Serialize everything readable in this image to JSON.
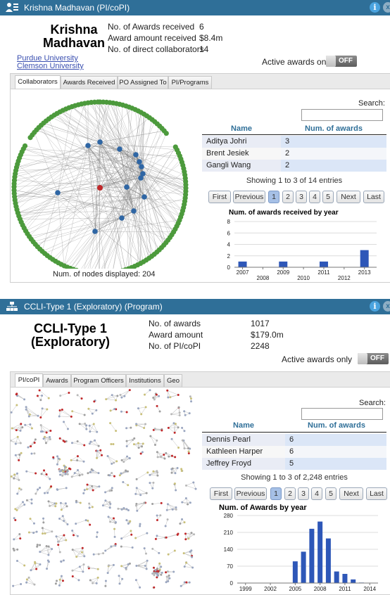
{
  "p1": {
    "title": "Krishna Madhavan (PI/coPI)",
    "info_glyph": "i",
    "close_glyph": "x",
    "name_line1": "Krishna",
    "name_line2": "Madhavan",
    "stats": [
      {
        "label": "No. of Awards received",
        "value": "6"
      },
      {
        "label": "Award amount received",
        "value": "$8.4m"
      },
      {
        "label": "No. of direct collaborators",
        "value": "14"
      }
    ],
    "links": [
      "Purdue University",
      "Clemson University"
    ],
    "active_label": "Active awards only",
    "toggle_label": "OFF",
    "tabs": [
      "Collaborators",
      "Awards Received",
      "PO Assigned To",
      "PI/Programs"
    ],
    "search_label": "Search:",
    "columns": [
      "Name",
      "Num. of awards"
    ],
    "rows": [
      {
        "name": "Aditya Johri",
        "value": "3"
      },
      {
        "name": "Brent Jesiek",
        "value": "2"
      },
      {
        "name": "Gangli Wang",
        "value": "2"
      }
    ],
    "showing": "Showing 1 to 3 of 14 entries",
    "pager": [
      "First",
      "Previous",
      "1",
      "2",
      "3",
      "4",
      "5",
      "Next",
      "Last"
    ],
    "nodes_label": "Num. of nodes displayed: 204",
    "colors": {
      "node_blue": "#2f66a4",
      "node_red": "#c0282a",
      "ring_green": "#4c9a3c",
      "bar": "#2e57b8"
    }
  },
  "p2": {
    "title": "CCLI-Type 1 (Exploratory) (Program)",
    "info_glyph": "i",
    "close_glyph": "x",
    "name_line1": "CCLI-Type 1",
    "name_line2": "(Exploratory)",
    "stats": [
      {
        "label": "No. of awards",
        "value": "1017"
      },
      {
        "label": "Award amount",
        "value": "$179.0m"
      },
      {
        "label": "No. of PI/coPI",
        "value": "2248"
      }
    ],
    "active_label": "Active awards only",
    "toggle_label": "OFF",
    "tabs": [
      "PI/coPI",
      "Awards",
      "Program Officers",
      "Institutions",
      "Geo"
    ],
    "search_label": "Search:",
    "columns": [
      "Name",
      "Num. of awards"
    ],
    "rows": [
      {
        "name": "Dennis Pearl",
        "value": "6"
      },
      {
        "name": "Kathleen Harper",
        "value": "6"
      },
      {
        "name": "Jeffrey Froyd",
        "value": "5"
      }
    ],
    "showing": "Showing 1 to 3 of 2,248 entries",
    "pager": [
      "First",
      "Previous",
      "1",
      "2",
      "3",
      "4",
      "5",
      "Next",
      "Last"
    ]
  },
  "chart_data": [
    {
      "type": "bar",
      "title": "Num. of awards received by year",
      "x": [
        2007,
        2008,
        2009,
        2010,
        2011,
        2012,
        2013
      ],
      "values": [
        1,
        0,
        1,
        0,
        1,
        0,
        3
      ],
      "xticks_top": [
        "2007",
        "2009",
        "2011",
        "2013"
      ],
      "xticks_bottom": [
        "2008",
        "2010",
        "2012"
      ],
      "yticks": [
        "0",
        "2",
        "4",
        "6",
        "8"
      ],
      "ylim": [
        0,
        8
      ],
      "xlim": [
        2006.6,
        2013.6
      ],
      "grid": true
    },
    {
      "type": "bar",
      "title": "Num. of Awards by year",
      "x": [
        2005,
        2006,
        2007,
        2008,
        2009,
        2010,
        2011,
        2012,
        2013
      ],
      "values": [
        90,
        130,
        225,
        255,
        185,
        48,
        38,
        15,
        2
      ],
      "xticks": [
        "1999",
        "2002",
        "2005",
        "2008",
        "2011",
        "2014"
      ],
      "yticks": [
        "0",
        "70",
        "140",
        "210",
        "280"
      ],
      "ylim": [
        0,
        280
      ],
      "xlim": [
        1998,
        2015
      ],
      "grid": true
    }
  ]
}
